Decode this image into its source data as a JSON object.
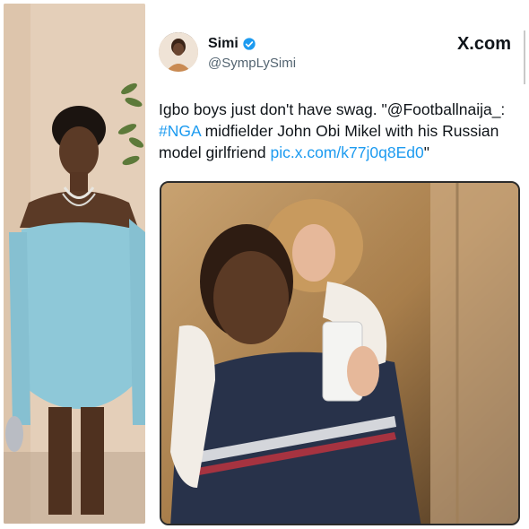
{
  "left_photo": {
    "description_icon": "person-in-blue-dress-photo"
  },
  "tweet": {
    "author_name": "Simi",
    "author_handle": "@SympLySimi",
    "platform_label": "X.com",
    "verified_icon": "verified-badge-icon",
    "text_prefix": "Igbo boys just don't have swag. \"@Footballnaija_: ",
    "hashtag": "#NGA",
    "text_middle": " midfielder John Obi Mikel with his Russian model girlfriend ",
    "link": "pic.x.com/k77j0q8Ed0",
    "text_suffix": "\""
  },
  "colors": {
    "accent": "#1d9bf0",
    "text": "#0f1419",
    "muted": "#536471"
  }
}
